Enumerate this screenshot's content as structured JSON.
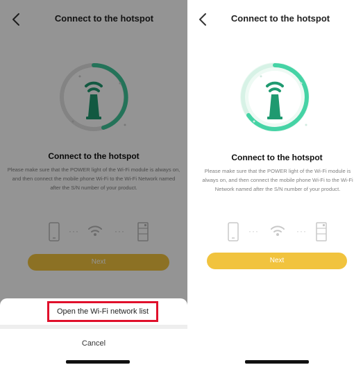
{
  "screens": [
    {
      "title": "Connect to the hotspot",
      "heading": "Connect to the hotspot",
      "description": "Please make sure that the POWER light of the Wi-Fi module is always on, and then connect the mobile phone Wi-Fi to the Wi-Fi Network named after the S/N number of your product.",
      "next_label": "Next",
      "dots": "···",
      "action_sheet": {
        "open_wifi_label": "Open the Wi-Fi network list",
        "cancel_label": "Cancel"
      }
    },
    {
      "title": "Connect to the hotspot",
      "heading": "Connect to the hotspot",
      "description": "Please make sure that the POWER light of the Wi-Fi module is always on, and then connect the mobile phone Wi-Fi to the Wi-Fi Network named after the S/N number of your product.",
      "next_label": "Next",
      "dots": "···"
    }
  ],
  "colors": {
    "accent_yellow": "#f1c33e",
    "ring_green": "#3fc79a",
    "highlight_red": "#e0102b",
    "icon_gray": "#b8b8b8"
  },
  "icons": [
    "back-chevron-icon",
    "hotspot-device-icon",
    "phone-icon",
    "wifi-icon",
    "router-icon"
  ]
}
